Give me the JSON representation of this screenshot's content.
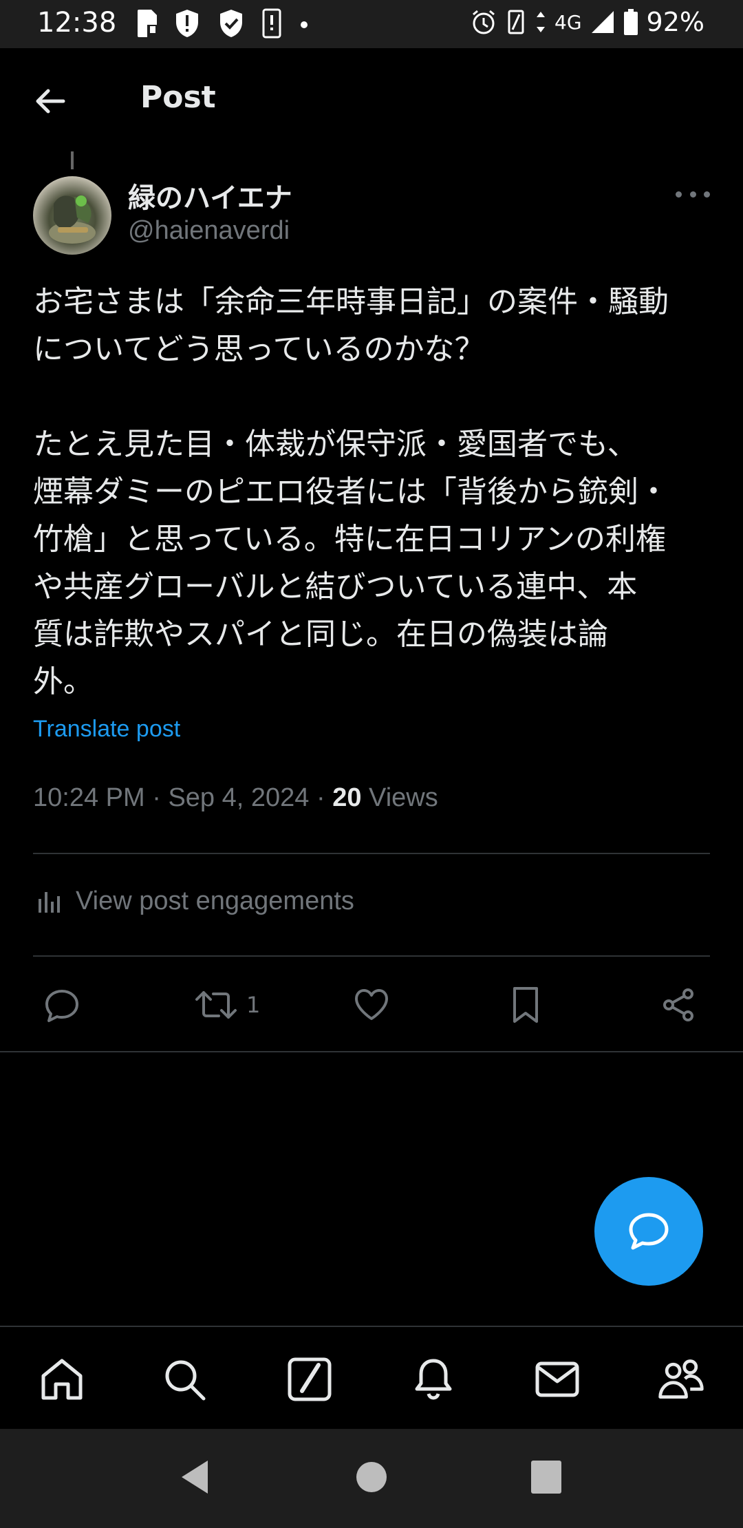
{
  "status_bar": {
    "time": "12:38",
    "network": "4G",
    "battery": "92%",
    "icons": [
      "sd-card-icon",
      "alert-shield-icon",
      "check-shield-icon",
      "device-info-icon",
      "dot-icon",
      "alarm-icon",
      "vibrate-icon",
      "data-arrows-icon",
      "signal-icon",
      "battery-icon"
    ]
  },
  "header": {
    "title": "Post",
    "back_icon": "arrow-left-icon"
  },
  "post": {
    "author": {
      "display_name": "緑のハイエナ",
      "handle": "@haienaverdi"
    },
    "text": "お宅さまは「余命三年時事日記」の案件・騒動\nについてどう思っているのかな？\n\nたとえ見た目・体裁が保守派・愛国者でも、\n煙幕ダミーのピエロ役者には「背後から銃剣・\n竹槍」と思っている。特に在日コリアンの利権\nや共産グローバルと結びついている連中、本\n質は詐欺やスパイと同じ。在日の偽装は論\n外。",
    "translate_label": "Translate post",
    "time": "10:24 PM",
    "date": "Sep 4, 2024",
    "separator": "·",
    "views_count": "20",
    "views_label": "Views",
    "engagements_label": "View post engagements",
    "actions": {
      "reply_count": "",
      "repost_count": "1",
      "like_count": ""
    }
  },
  "bottom_nav": [
    "home-icon",
    "search-icon",
    "grok-icon",
    "notifications-icon",
    "messages-icon",
    "communities-icon"
  ],
  "colors": {
    "accent": "#1d9bf0",
    "background": "#000000",
    "secondary_text": "#71767b",
    "primary_text": "#e7e9ea"
  }
}
